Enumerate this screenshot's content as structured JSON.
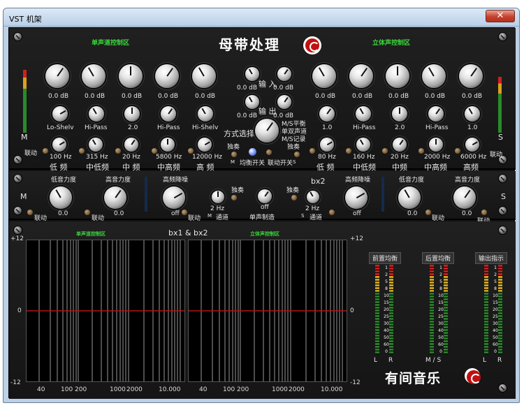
{
  "window": {
    "title": "VST 机架",
    "close_glyph": "✕"
  },
  "header": {
    "mono_zone": "单声道控制区",
    "main_title": "母带处理",
    "stereo_zone": "立体声控制区"
  },
  "colors": {
    "accent_green": "#3ad83a",
    "plot_zero_line": "#b21515",
    "brand_red": "#c01010"
  },
  "mono": {
    "gain_values": [
      "0.0 dB",
      "0.0 dB",
      "0.0 dB",
      "0.0 dB",
      "0.0 dB"
    ],
    "filter_labels": [
      "Lo-Shelv",
      "Hi-Pass",
      "2.0",
      "Hi-Pass",
      "Hi-Shelv"
    ],
    "freqs": [
      "100 Hz",
      "315 Hz",
      "20 Hz",
      "5800 Hz",
      "12000 Hz"
    ],
    "bands": [
      "低 频",
      "中低频",
      "中 频",
      "中高频",
      "高 频"
    ],
    "side_letter": "M",
    "link": "联动"
  },
  "stereo": {
    "gain_values": [
      "0.0 dB",
      "0.0 dB",
      "0.0 dB",
      "0.0 dB",
      "0.0 dB"
    ],
    "filter_labels": [
      "1.0",
      "Hi-Pass",
      "2.0",
      "Hi-Pass",
      "1.0"
    ],
    "freqs": [
      "80 Hz",
      "160 Hz",
      "20 Hz",
      "2000 Hz",
      "6000 Hz"
    ],
    "bands": [
      "低 频",
      "中低频",
      "中频",
      "中高频",
      "高频"
    ],
    "side_letter": "S",
    "link": "联动"
  },
  "center": {
    "input": "输 入",
    "output": "输 出",
    "input_l": "0.0 dB",
    "input_r": "0.0 dB",
    "output_l": "0.0 dB",
    "output_r": "0.0 dB",
    "mode_label": "方式选择",
    "mode_options": [
      "M/S平衡",
      "单双声道",
      "M/S记录"
    ],
    "solo_left": "独奏",
    "solo_right": "独奏",
    "m_letter": "M",
    "s_letter": "S",
    "balance_switch": "均衡开关",
    "link_switch": "联动开关"
  },
  "rack2": {
    "low_force": "低音力度",
    "high_force": "高音力度",
    "hf_noise": "高频降噪",
    "low_force_r": "低音力度",
    "high_force_r": "高音力度",
    "hf_noise_r": "高频降噪",
    "val_l1": "0.0",
    "val_l2": "0.0",
    "off_l": "off",
    "val_r1": "0.0",
    "val_r2": "0.0",
    "off_r": "off",
    "solo_l": "独奏",
    "solo_r": "独奏",
    "hz_l": "2 Hz",
    "hz_r": "2 Hz",
    "chan_l": "通道",
    "chan_r": "通道",
    "m": "M",
    "s": "S",
    "mono_make": "单声制造",
    "mono_off": "off",
    "bx2": "bx2",
    "link": "联动"
  },
  "analyzer": {
    "mono_zone": "单声道控制区",
    "bx_title": "bx1 & bx2",
    "stereo_zone": "立体声控制区",
    "y_top": "+12",
    "y_mid": "0",
    "y_bot": "-12",
    "x_left": [
      "40",
      "100",
      "200",
      "1000",
      "2000",
      "10.000"
    ],
    "x_right": [
      "40",
      "100",
      "200",
      "1000",
      "2000",
      "10.000"
    ]
  },
  "meters": {
    "titles": [
      "前置均衡",
      "后置均衡",
      "输出指示"
    ],
    "scale": [
      "1",
      "2",
      "5",
      "8",
      "10",
      "15",
      "20",
      "25",
      "30",
      "40",
      "50",
      "60",
      "0"
    ],
    "foot_left": [
      "L",
      "R"
    ],
    "foot_mid": "M / S",
    "foot_right": [
      "L",
      "R"
    ]
  },
  "brand": "有间音乐"
}
